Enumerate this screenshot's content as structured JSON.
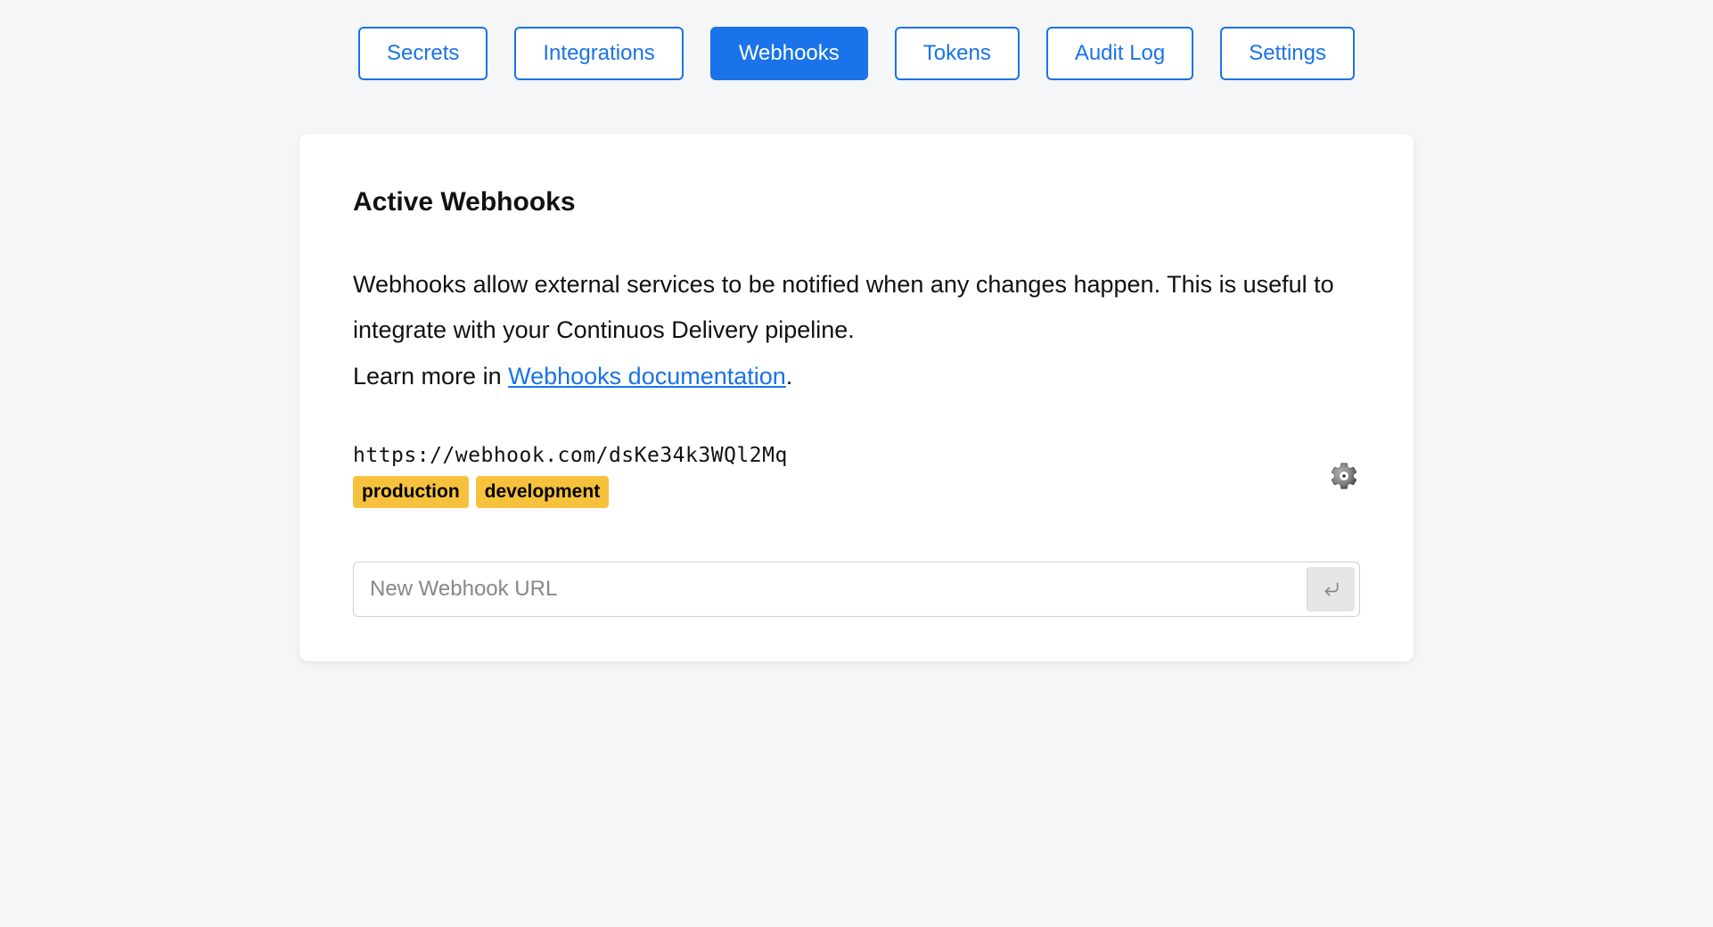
{
  "tabs": [
    {
      "label": "Secrets",
      "active": false
    },
    {
      "label": "Integrations",
      "active": false
    },
    {
      "label": "Webhooks",
      "active": true
    },
    {
      "label": "Tokens",
      "active": false
    },
    {
      "label": "Audit Log",
      "active": false
    },
    {
      "label": "Settings",
      "active": false
    }
  ],
  "panel": {
    "title": "Active Webhooks",
    "description_line1": "Webhooks allow external services to be notified when any changes happen. This is useful to integrate with your Continuos Delivery pipeline.",
    "description_line2_prefix": "Learn more in ",
    "doc_link_text": "Webhooks documentation",
    "description_line2_suffix": "."
  },
  "webhooks": [
    {
      "url": "https://webhook.com/dsKe34k3WQl2Mq",
      "tags": [
        "production",
        "development"
      ]
    }
  ],
  "new_webhook": {
    "placeholder": "New Webhook URL",
    "value": ""
  }
}
